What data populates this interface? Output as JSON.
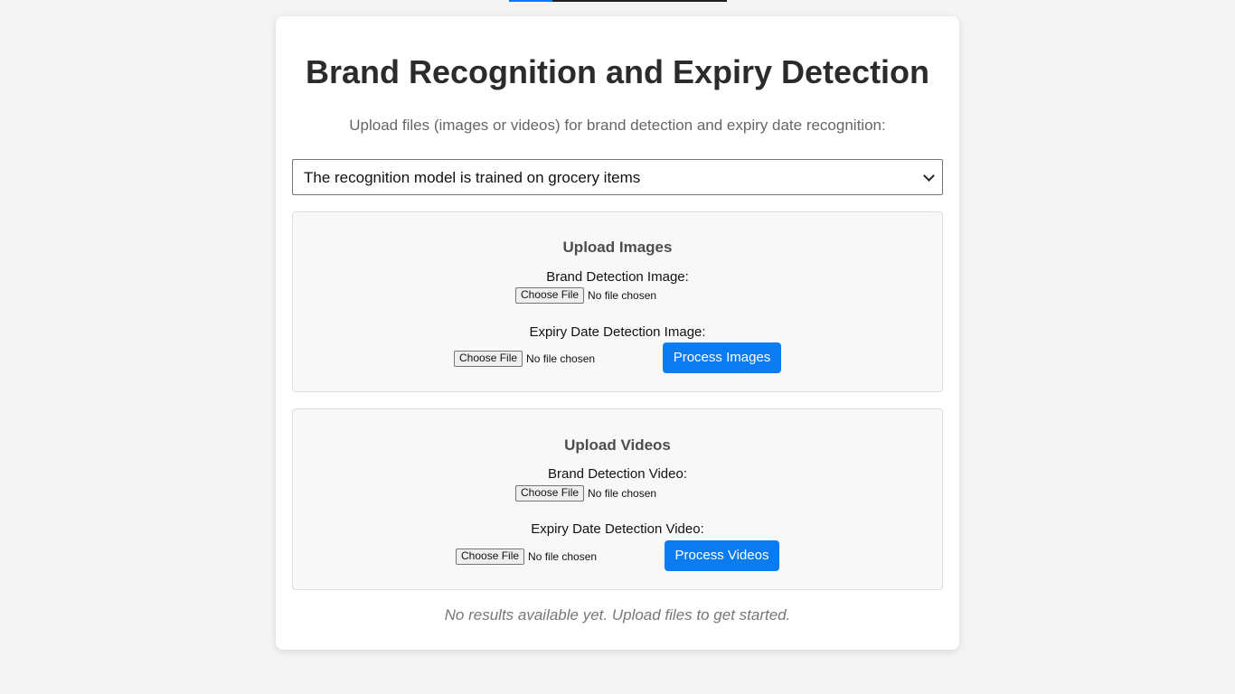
{
  "progress": {
    "fraction": 0.2,
    "bar_color": "#1f1f1f",
    "fill_color": "#0a7cf0"
  },
  "page": {
    "title": "Brand Recognition and Expiry Detection",
    "subtitle": "Upload files (images or videos) for brand detection and expiry date recognition:"
  },
  "model_select": {
    "selected": "The recognition model is trained on grocery items"
  },
  "images": {
    "heading": "Upload Images",
    "brand_label": "Brand Detection Image:",
    "expiry_label": "Expiry Date Detection Image:",
    "choose_label": "Choose File",
    "no_file": "No file chosen",
    "process_label": "Process Images"
  },
  "videos": {
    "heading": "Upload Videos",
    "brand_label": "Brand Detection Video:",
    "expiry_label": "Expiry Date Detection Video:",
    "choose_label": "Choose File",
    "no_file": "No file chosen",
    "process_label": "Process Videos"
  },
  "results": {
    "empty_message": "No results available yet. Upload files to get started."
  },
  "colors": {
    "accent": "#0a7cf0",
    "background": "#f4f4f4",
    "card": "#ffffff",
    "panel": "#f8f8f8"
  }
}
